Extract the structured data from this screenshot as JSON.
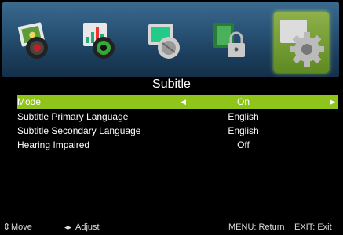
{
  "iconbar": {
    "icons": [
      {
        "name": "picture-menu-icon"
      },
      {
        "name": "sound-menu-icon"
      },
      {
        "name": "channel-menu-icon"
      },
      {
        "name": "lock-menu-icon"
      },
      {
        "name": "setup-menu-icon",
        "active": true
      }
    ],
    "active_color": "#8fc41a"
  },
  "page": {
    "title": "Subitle"
  },
  "menu": {
    "items": [
      {
        "label": "Mode",
        "value": "On",
        "selected": true
      },
      {
        "label": "Subtitle Primary Language",
        "value": "English"
      },
      {
        "label": "Subtitle Secondary Language",
        "value": "English"
      },
      {
        "label": "Hearing Impaired",
        "value": "Off"
      }
    ],
    "left_arrow": "◀",
    "right_arrow": "▶",
    "highlight_color": "#8fc41a"
  },
  "footer": {
    "move": "Move",
    "adjust": "Adjust",
    "menu_return": "MENU: Return",
    "exit": "EXIT: Exit"
  }
}
